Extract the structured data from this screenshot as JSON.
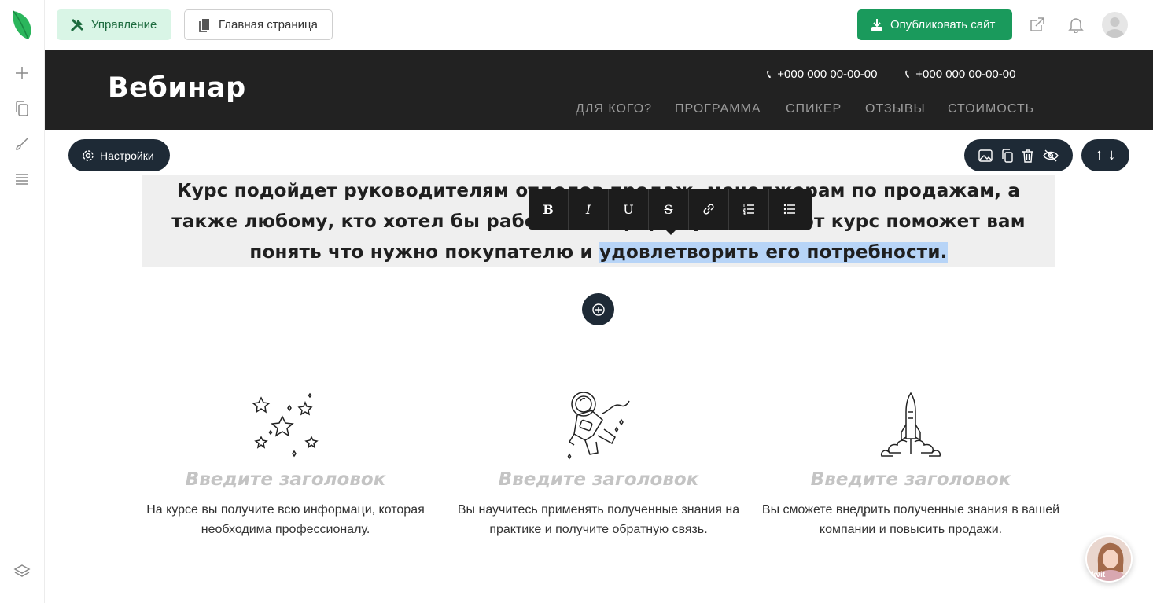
{
  "colors": {
    "accent": "#1a9a5c",
    "dark": "#1e2a36",
    "header_bg": "#222222",
    "highlight": "#b7d4f7"
  },
  "sidebar": {
    "items": [
      {
        "icon": "plus-icon"
      },
      {
        "icon": "pages-icon"
      },
      {
        "icon": "brush-icon"
      },
      {
        "icon": "sections-icon"
      },
      {
        "icon": "layers-icon"
      }
    ]
  },
  "topbar": {
    "manage_label": "Управление",
    "home_label": "Главная страница",
    "publish_label": "Опубликовать сайт",
    "icons": [
      "external-link-icon",
      "bell-icon",
      "user-avatar-icon"
    ]
  },
  "site_header": {
    "title": "Вебинар",
    "phones": [
      "+000 000 00-00-00",
      "+000 000 00-00-00"
    ],
    "nav": [
      "ДЛЯ КОГО?",
      "ПРОГРАММА",
      "СПИКЕР",
      "ОТЗЫВЫ",
      "СТОИМОСТЬ"
    ]
  },
  "block_controls": {
    "settings_label": "Настройки",
    "tools": [
      "image-icon",
      "copy-icon",
      "trash-icon",
      "hide-icon"
    ],
    "move": [
      "↑",
      "↓"
    ]
  },
  "editor": {
    "text_before": "Курс подойдет руководителям отделов продаж, менеджерам по продажам, а также любому, кто хотел бы работать в сфере продаж. Этот курс поможет вам понять что нужно покупателю и ",
    "text_selected": "удовлетворить его потребности.",
    "format_buttons": [
      "B",
      "I",
      "U",
      "S",
      "link-icon",
      "ordered-list-icon",
      "bullet-list-icon"
    ]
  },
  "features": [
    {
      "icon": "stars-icon",
      "title": "Введите заголовок",
      "text": "На курсе вы получите всю информаци, которая необходима профессионалу."
    },
    {
      "icon": "astronaut-icon",
      "title": "Введите заголовок",
      "text": "Вы научитесь применять полученные знания на практике и получите обратную связь."
    },
    {
      "icon": "rocket-icon",
      "title": "Введите заголовок",
      "text": "Вы сможете внедрить полученные знания в вашей компании и повысить продажи."
    }
  ],
  "chat": {
    "label": "kvit"
  }
}
